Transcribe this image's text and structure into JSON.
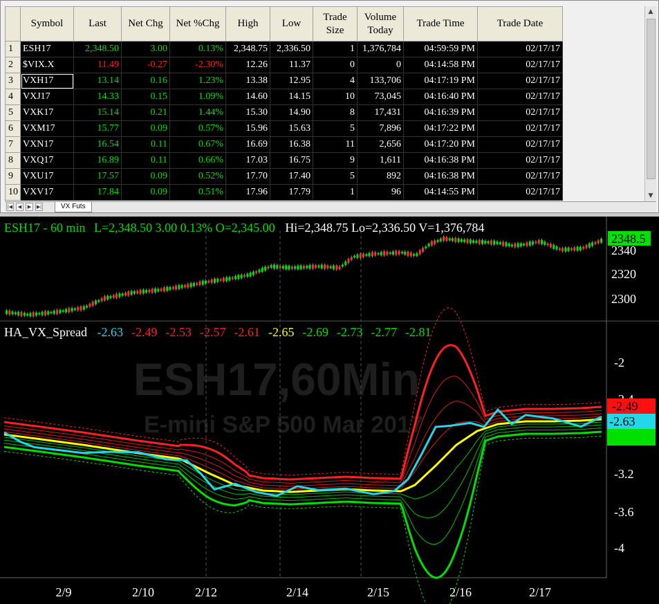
{
  "quote_table": {
    "headers": [
      "Symbol",
      "Last",
      "Net Chg",
      "Net %Chg",
      "High",
      "Low",
      "Trade Size",
      "Volume Today",
      "Trade Time",
      "Trade Date"
    ],
    "rows": [
      {
        "n": "1",
        "symbol": "ESH17",
        "last": "2,348.50",
        "net_chg": "3.00",
        "pct_chg": "0.13%",
        "high": "2,348.75",
        "low": "2,336.50",
        "size": "1",
        "volume": "1,376,784",
        "time": "04:59:59 PM",
        "date": "02/17/17",
        "dir": "up"
      },
      {
        "n": "2",
        "symbol": "$VIX.X",
        "last": "11.49",
        "net_chg": "-0.27",
        "pct_chg": "-2.30%",
        "high": "12.26",
        "low": "11.37",
        "size": "0",
        "volume": "0",
        "time": "04:14:58 PM",
        "date": "02/17/17",
        "dir": "dn"
      },
      {
        "n": "3",
        "symbol": "VXH17",
        "last": "13.14",
        "net_chg": "0.16",
        "pct_chg": "1.23%",
        "high": "13.38",
        "low": "12.95",
        "size": "4",
        "volume": "133,706",
        "time": "04:17:19 PM",
        "date": "02/17/17",
        "dir": "up"
      },
      {
        "n": "4",
        "symbol": "VXJ17",
        "last": "14.33",
        "net_chg": "0.15",
        "pct_chg": "1.09%",
        "high": "14.60",
        "low": "14.15",
        "size": "10",
        "volume": "73,045",
        "time": "04:16:40 PM",
        "date": "02/17/17",
        "dir": "up"
      },
      {
        "n": "5",
        "symbol": "VXK17",
        "last": "15.14",
        "net_chg": "0.21",
        "pct_chg": "1.44%",
        "high": "15.30",
        "low": "14.90",
        "size": "8",
        "volume": "17,431",
        "time": "04:16:39 PM",
        "date": "02/17/17",
        "dir": "up"
      },
      {
        "n": "6",
        "symbol": "VXM17",
        "last": "15.77",
        "net_chg": "0.09",
        "pct_chg": "0.57%",
        "high": "15.96",
        "low": "15.63",
        "size": "5",
        "volume": "7,896",
        "time": "04:17:22 PM",
        "date": "02/17/17",
        "dir": "up"
      },
      {
        "n": "7",
        "symbol": "VXN17",
        "last": "16.54",
        "net_chg": "0.11",
        "pct_chg": "0.67%",
        "high": "16.69",
        "low": "16.38",
        "size": "11",
        "volume": "2,656",
        "time": "04:17:20 PM",
        "date": "02/17/17",
        "dir": "up"
      },
      {
        "n": "8",
        "symbol": "VXQ17",
        "last": "16.89",
        "net_chg": "0.11",
        "pct_chg": "0.66%",
        "high": "17.03",
        "low": "16.75",
        "size": "9",
        "volume": "1,611",
        "time": "04:16:38 PM",
        "date": "02/17/17",
        "dir": "up"
      },
      {
        "n": "9",
        "symbol": "VXU17",
        "last": "17.57",
        "net_chg": "0.09",
        "pct_chg": "0.52%",
        "high": "17.70",
        "low": "17.40",
        "size": "5",
        "volume": "892",
        "time": "04:16:38 PM",
        "date": "02/17/17",
        "dir": "up"
      },
      {
        "n": "10",
        "symbol": "VXV17",
        "last": "17.84",
        "net_chg": "0.09",
        "pct_chg": "0.51%",
        "high": "17.96",
        "low": "17.79",
        "size": "1",
        "volume": "96",
        "time": "04:14:55 PM",
        "date": "02/17/17",
        "dir": "up"
      }
    ]
  },
  "tabbar": {
    "tab_label": "VX Futs"
  },
  "price_chart": {
    "title": "ESH17 - 60 min",
    "stats": "L=2,348.50  3.00  0.13%  O=2,345.00",
    "hilo": "Hi=2,348.75  Lo=2,336.50  V=1,376,784",
    "last_tag": "2348.5",
    "y_ticks": [
      "2340",
      "2320",
      "2300"
    ]
  },
  "indicator": {
    "name": "HA_VX_Spread",
    "values": [
      {
        "v": "-2.63",
        "color": "#22d8e8"
      },
      {
        "v": "-2.49",
        "color": "#ff2020"
      },
      {
        "v": "-2.53",
        "color": "#ff2020"
      },
      {
        "v": "-2.57",
        "color": "#ff2020"
      },
      {
        "v": "-2.61",
        "color": "#ff2020"
      },
      {
        "v": "-2.65",
        "color": "#ffff00"
      },
      {
        "v": "-2.69",
        "color": "#00e000"
      },
      {
        "v": "-2.73",
        "color": "#00e000"
      },
      {
        "v": "-2.77",
        "color": "#00e000"
      },
      {
        "v": "-2.81",
        "color": "#00e000"
      }
    ],
    "y_ticks": [
      "-2",
      "-2.4",
      "-3.2",
      "-3.6",
      "-4"
    ],
    "tag_red": "-2.49",
    "tag_cyan": "-2.63",
    "watermark_1": "ESH17,60Min",
    "watermark_2": "E-mini S&P 500 Mar 2017"
  },
  "x_axis": {
    "labels": [
      "2/9",
      "2/10",
      "2/12",
      "2/14",
      "2/15",
      "2/16",
      "2/17"
    ]
  },
  "colors": {
    "up": "#00e000",
    "down": "#ff2020",
    "cyan": "#22d8e8",
    "yellow": "#ffff00"
  }
}
